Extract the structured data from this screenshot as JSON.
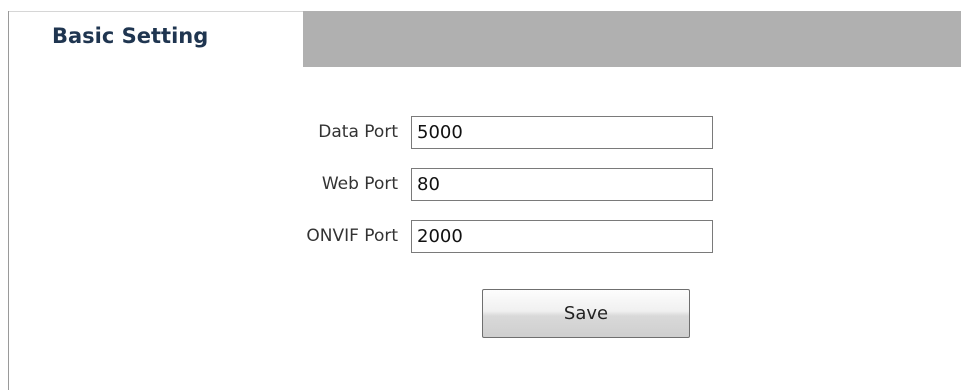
{
  "tab": {
    "title": "Basic Setting"
  },
  "form": {
    "rows": [
      {
        "label": "Data Port",
        "value": "5000"
      },
      {
        "label": "Web Port",
        "value": "80"
      },
      {
        "label": "ONVIF Port",
        "value": "2000"
      }
    ],
    "save_label": "Save"
  },
  "colors": {
    "header_bar": "#b0b0b0",
    "tab_title": "#1f3550"
  }
}
